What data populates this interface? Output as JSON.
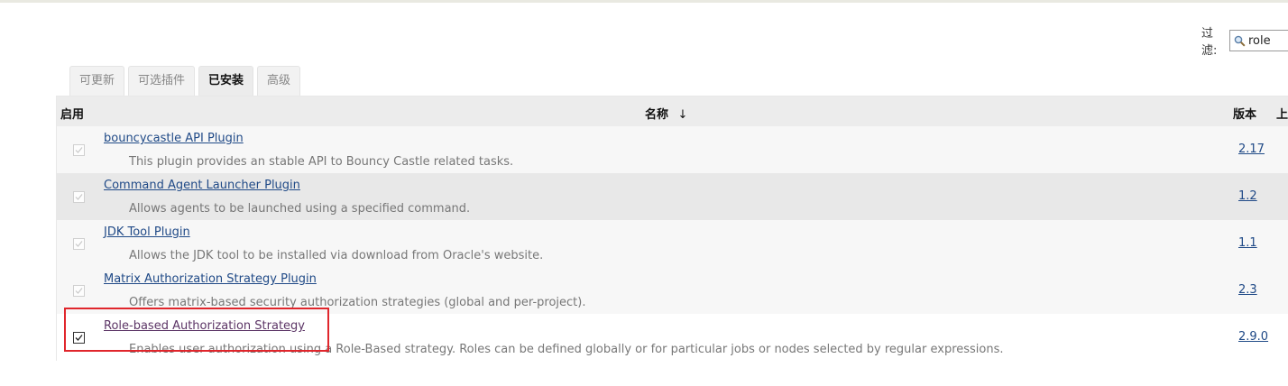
{
  "filter": {
    "label": "过滤:",
    "value": "role",
    "icon": "magnifier-icon"
  },
  "tabs": [
    {
      "label": "可更新",
      "active": false
    },
    {
      "label": "可选插件",
      "active": false
    },
    {
      "label": "已安装",
      "active": true
    },
    {
      "label": "高级",
      "active": false
    }
  ],
  "table": {
    "headers": {
      "enabled": "启用",
      "name": "名称",
      "sort_arrow": "↓",
      "version": "版本",
      "previous": "上"
    },
    "rows": [
      {
        "name": "bouncycastle API Plugin",
        "description": "This plugin provides an stable API to Bouncy Castle related tasks.",
        "version": "2.17",
        "enabled": true,
        "editable": false
      },
      {
        "name": "Command Agent Launcher Plugin",
        "description": "Allows agents to be launched using a specified command.",
        "version": "1.2",
        "enabled": true,
        "editable": false
      },
      {
        "name": "JDK Tool Plugin",
        "description": "Allows the JDK tool to be installed via download from Oracle's website.",
        "version": "1.1",
        "enabled": true,
        "editable": false
      },
      {
        "name": "Matrix Authorization Strategy Plugin",
        "description": "Offers matrix-based security authorization strategies (global and per-project).",
        "version": "2.3",
        "enabled": true,
        "editable": false
      },
      {
        "name": "Role-based Authorization Strategy",
        "description": "Enables user authorization using a Role-Based strategy. Roles can be defined globally or for particular jobs or nodes selected by regular expressions.",
        "version": "2.9.0",
        "enabled": true,
        "editable": true
      }
    ]
  },
  "colors": {
    "link": "#204a87",
    "visited_link": "#5c3566",
    "highlight_box": "#e0262c"
  }
}
